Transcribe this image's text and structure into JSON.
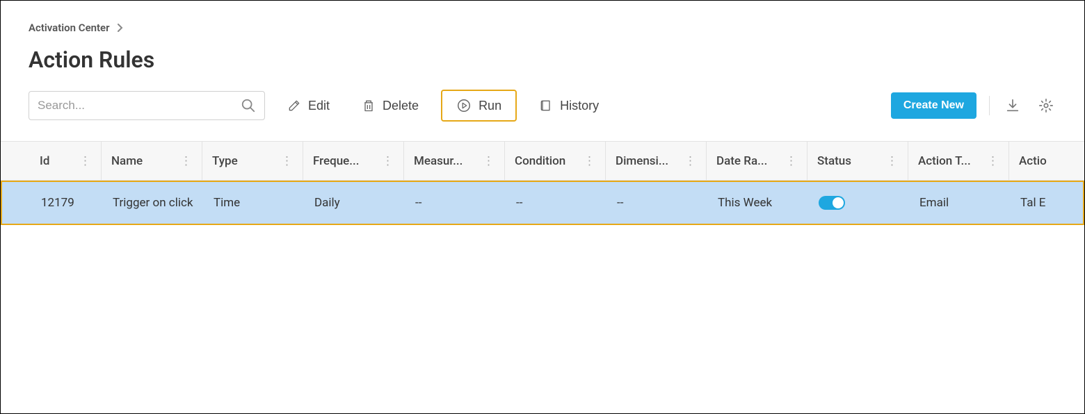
{
  "breadcrumb": {
    "parent": "Activation Center"
  },
  "page": {
    "title": "Action Rules"
  },
  "search": {
    "placeholder": "Search..."
  },
  "toolbar": {
    "edit": "Edit",
    "delete": "Delete",
    "run": "Run",
    "history": "History",
    "create": "Create New"
  },
  "columns": {
    "id": "Id",
    "name": "Name",
    "type": "Type",
    "freq": "Freque...",
    "meas": "Measur...",
    "cond": "Condition",
    "dim": "Dimensi...",
    "date": "Date Ra...",
    "status": "Status",
    "atype": "Action T...",
    "actio": "Actio"
  },
  "rows": [
    {
      "id": "12179",
      "name": "Trigger on click",
      "type": "Time",
      "freq": "Daily",
      "meas": "--",
      "cond": "--",
      "dim": "--",
      "date": "This Week",
      "status_on": true,
      "atype": "Email",
      "actio": "Tal E"
    }
  ]
}
